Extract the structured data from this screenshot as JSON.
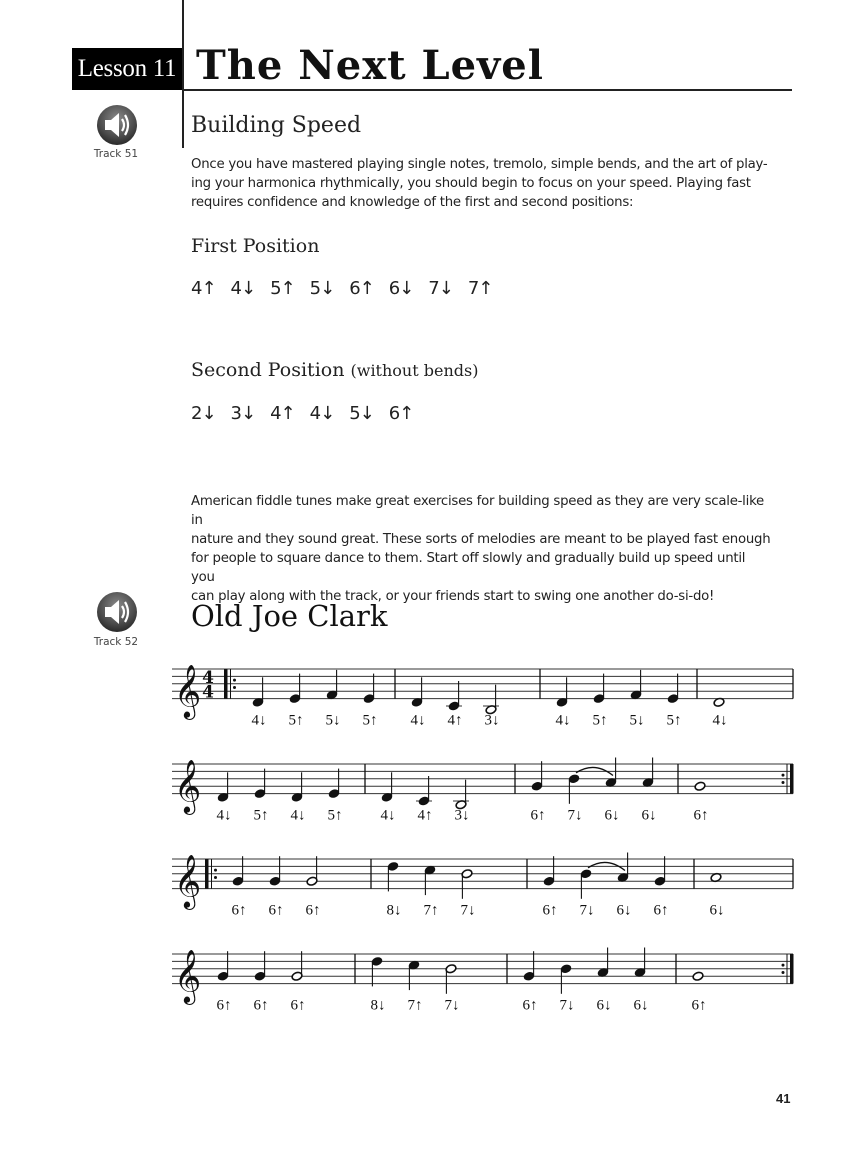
{
  "header": {
    "lesson_label": "Lesson 11",
    "title": "The Next Level"
  },
  "section": {
    "heading": "Building Speed",
    "track": "Track 51",
    "intro": "Once you have mastered playing single notes, tremolo, simple bends, and the art of playing your harmonica rhythmically, you should begin to focus on your speed. Playing fast requires confidence and knowledge of the first and second positions:",
    "intro_lines": [
      "Once you have mastered playing single notes, tremolo, simple bends, and the art of play-",
      "ing your harmonica rhythmically, you should begin to focus on your speed. Playing fast",
      "requires confidence and knowledge of the first and second positions:"
    ],
    "first_position": {
      "heading": "First Position",
      "notes": [
        "4↑",
        "4↓",
        "5↑",
        "5↓",
        "6↑",
        "6↓",
        "7↓",
        "7↑"
      ]
    },
    "second_position": {
      "heading": "Second Position",
      "heading_note": "(without bends)",
      "notes": [
        "2↓",
        "3↓",
        "4↑",
        "4↓",
        "5↓",
        "6↑"
      ]
    },
    "fiddle_text_lines": [
      "American fiddle tunes make great exercises for building speed as they are very scale-like in",
      "nature and they sound great. These sorts of melodies are meant to be played fast enough",
      "for people to square dance to them. Start off slowly and gradually build up speed until you",
      "can play along with the track, or your friends start to swing one another do-si-do!"
    ]
  },
  "song": {
    "title": "Old Joe Clark",
    "track": "Track 52",
    "clef": "treble",
    "time_signature": "4/4",
    "staves": [
      {
        "start_repeat": true,
        "show_time": true,
        "end": "barline",
        "measures": [
          {
            "notes": [
              {
                "pitch": "D4",
                "dur": "q",
                "tab": "4↓"
              },
              {
                "pitch": "E4",
                "dur": "q",
                "tab": "5↑"
              },
              {
                "pitch": "F4",
                "dur": "q",
                "tab": "5↓"
              },
              {
                "pitch": "E4",
                "dur": "q",
                "tab": "5↑"
              }
            ]
          },
          {
            "notes": [
              {
                "pitch": "D4",
                "dur": "q",
                "tab": "4↓"
              },
              {
                "pitch": "C4",
                "dur": "q",
                "tab": "4↑"
              },
              {
                "pitch": "B3",
                "dur": "h",
                "tab": "3↓"
              }
            ]
          },
          {
            "notes": [
              {
                "pitch": "D4",
                "dur": "q",
                "tab": "4↓"
              },
              {
                "pitch": "E4",
                "dur": "q",
                "tab": "5↑"
              },
              {
                "pitch": "F4",
                "dur": "q",
                "tab": "5↓"
              },
              {
                "pitch": "E4",
                "dur": "q",
                "tab": "5↑"
              }
            ]
          },
          {
            "notes": [
              {
                "pitch": "D4",
                "dur": "w",
                "tab": "4↓"
              }
            ]
          }
        ]
      },
      {
        "start_repeat": false,
        "show_time": false,
        "end": "repeat",
        "measures": [
          {
            "notes": [
              {
                "pitch": "D4",
                "dur": "q",
                "tab": "4↓"
              },
              {
                "pitch": "E4",
                "dur": "q",
                "tab": "5↑"
              },
              {
                "pitch": "D4",
                "dur": "q",
                "tab": "4↓"
              },
              {
                "pitch": "E4",
                "dur": "q",
                "tab": "5↑"
              }
            ]
          },
          {
            "notes": [
              {
                "pitch": "D4",
                "dur": "q",
                "tab": "4↓"
              },
              {
                "pitch": "C4",
                "dur": "q",
                "tab": "4↑"
              },
              {
                "pitch": "B3",
                "dur": "h",
                "tab": "3↓"
              }
            ]
          },
          {
            "notes": [
              {
                "pitch": "G4",
                "dur": "q",
                "tab": "6↑"
              },
              {
                "pitch": "B4",
                "dur": "q",
                "tab": "7↓",
                "stem": "down",
                "slur_start": true
              },
              {
                "pitch": "A4",
                "dur": "q",
                "tab": "6↓",
                "slur_end": true
              },
              {
                "pitch": "A4",
                "dur": "q",
                "tab": "6↓"
              }
            ]
          },
          {
            "notes": [
              {
                "pitch": "G4",
                "dur": "w",
                "tab": "6↑"
              }
            ]
          }
        ]
      },
      {
        "start_repeat": true,
        "show_time": false,
        "end": "barline",
        "measures": [
          {
            "notes": [
              {
                "pitch": "G4",
                "dur": "q",
                "tab": "6↑"
              },
              {
                "pitch": "G4",
                "dur": "q",
                "tab": "6↑"
              },
              {
                "pitch": "G4",
                "dur": "h",
                "tab": "6↑"
              }
            ]
          },
          {
            "notes": [
              {
                "pitch": "D5",
                "dur": "q",
                "tab": "8↓",
                "stem": "down"
              },
              {
                "pitch": "C5",
                "dur": "q",
                "tab": "7↑",
                "stem": "down"
              },
              {
                "pitch": "B4",
                "dur": "h",
                "tab": "7↓",
                "stem": "down"
              }
            ]
          },
          {
            "notes": [
              {
                "pitch": "G4",
                "dur": "q",
                "tab": "6↑"
              },
              {
                "pitch": "B4",
                "dur": "q",
                "tab": "7↓",
                "stem": "down",
                "slur_start": true
              },
              {
                "pitch": "A4",
                "dur": "q",
                "tab": "6↓",
                "slur_end": true
              },
              {
                "pitch": "G4",
                "dur": "q",
                "tab": "6↑"
              }
            ]
          },
          {
            "notes": [
              {
                "pitch": "A4",
                "dur": "w",
                "tab": "6↓"
              }
            ]
          }
        ]
      },
      {
        "start_repeat": false,
        "show_time": false,
        "end": "repeat",
        "measures": [
          {
            "notes": [
              {
                "pitch": "G4",
                "dur": "q",
                "tab": "6↑"
              },
              {
                "pitch": "G4",
                "dur": "q",
                "tab": "6↑"
              },
              {
                "pitch": "G4",
                "dur": "h",
                "tab": "6↑"
              }
            ]
          },
          {
            "notes": [
              {
                "pitch": "D5",
                "dur": "q",
                "tab": "8↓",
                "stem": "down"
              },
              {
                "pitch": "C5",
                "dur": "q",
                "tab": "7↑",
                "stem": "down"
              },
              {
                "pitch": "B4",
                "dur": "h",
                "tab": "7↓",
                "stem": "down"
              }
            ]
          },
          {
            "notes": [
              {
                "pitch": "G4",
                "dur": "q",
                "tab": "6↑"
              },
              {
                "pitch": "B4",
                "dur": "q",
                "tab": "7↓",
                "stem": "down"
              },
              {
                "pitch": "A4",
                "dur": "q",
                "tab": "6↓"
              },
              {
                "pitch": "A4",
                "dur": "q",
                "tab": "6↓"
              }
            ]
          },
          {
            "notes": [
              {
                "pitch": "G4",
                "dur": "w",
                "tab": "6↑"
              }
            ]
          }
        ]
      }
    ]
  },
  "footer": {
    "page_number": "41"
  }
}
